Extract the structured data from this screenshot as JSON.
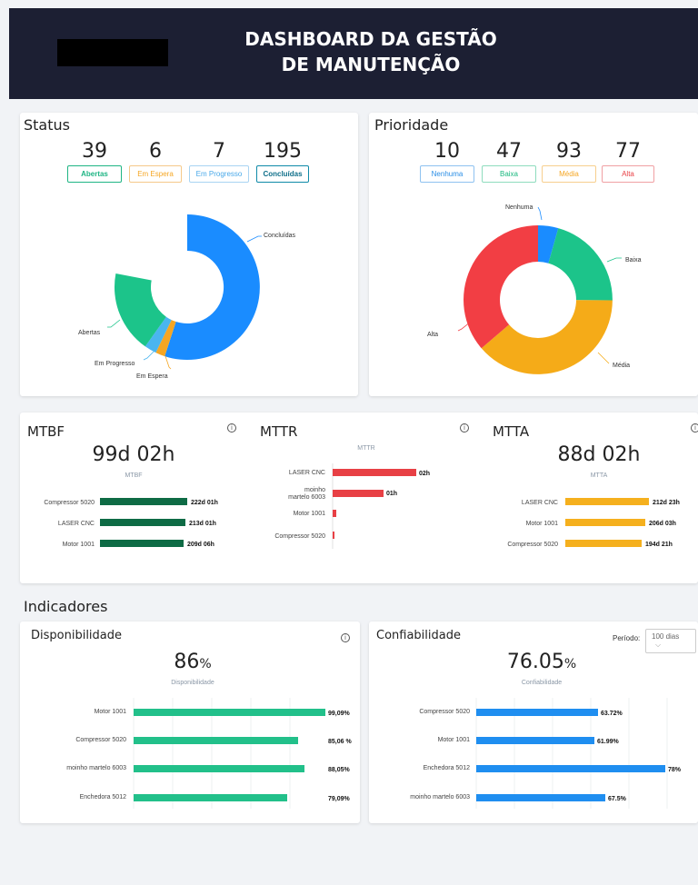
{
  "header": {
    "title_line1": "DASHBOARD DA GESTÃO",
    "title_line2": "DE MANUTENÇÃO"
  },
  "status": {
    "title": "Status",
    "counters": [
      {
        "value": "39",
        "label": "Abertas",
        "color": "#1fb584"
      },
      {
        "value": "6",
        "label": "Em Espera",
        "color": "#f5a623"
      },
      {
        "value": "7",
        "label": "Em Progresso",
        "color": "#4aa9e9"
      },
      {
        "value": "195",
        "label": "Concluídas",
        "color": "#0f8aa8"
      }
    ],
    "chart_labels": {
      "concluidas": "Concluídas",
      "abertas": "Abertas",
      "em_progresso": "Em Progresso",
      "em_espera": "Em Espera"
    }
  },
  "prioridade": {
    "title": "Prioridade",
    "counters": [
      {
        "value": "10",
        "label": "Nenhuma",
        "color": "#2a8ee6"
      },
      {
        "value": "47",
        "label": "Baixa",
        "color": "#19b87e"
      },
      {
        "value": "93",
        "label": "Média",
        "color": "#f5a623"
      },
      {
        "value": "77",
        "label": "Alta",
        "color": "#e84045"
      }
    ],
    "chart_labels": {
      "nenhuma": "Nenhuma",
      "baixa": "Baixa",
      "media": "Média",
      "alta": "Alta"
    }
  },
  "mtbf": {
    "title": "MTBF",
    "value": "99d 02h",
    "sub_label": "MTBF",
    "color": "#0e6b45",
    "bars": [
      {
        "label": "Compressor 5020",
        "value": "222d 01h"
      },
      {
        "label": "LASER CNC",
        "value": "213d 01h"
      },
      {
        "label": "Motor 1001",
        "value": "209d 06h"
      }
    ]
  },
  "mttr": {
    "title": "MTTR",
    "sub_label": "MTTR",
    "color": "#e84045",
    "bars": [
      {
        "label": "LASER CNC",
        "value": "02h"
      },
      {
        "label_line1": "moinho",
        "label_line2": "martelo 6003",
        "value": "01h"
      },
      {
        "label": "Motor 1001",
        "value": ""
      },
      {
        "label": "Compressor 5020",
        "value": ""
      }
    ]
  },
  "mtta": {
    "title": "MTTA",
    "value": "88d 02h",
    "sub_label": "MTTA",
    "color": "#f5b01e",
    "bars": [
      {
        "label": "LASER CNC",
        "value": "212d 23h"
      },
      {
        "label": "Motor 1001",
        "value": "206d 03h"
      },
      {
        "label": "Compressor 5020",
        "value": "194d 21h"
      }
    ]
  },
  "indicadores": {
    "title": "Indicadores",
    "disponibilidade": {
      "title": "Disponibilidade",
      "value": "86",
      "unit": "%",
      "sub_label": "Disponibilidade",
      "color": "#22c08a",
      "bars": [
        {
          "label": "Motor 1001",
          "value": "99,09%",
          "pct": 99.09
        },
        {
          "label": "Compressor 5020",
          "value": "85,06 %",
          "pct": 85.06
        },
        {
          "label": "moinho martelo 6003",
          "value": "88,05%",
          "pct": 88.05
        },
        {
          "label": "Enchedora 5012",
          "value": "79,09%",
          "pct": 79.09
        }
      ]
    },
    "confiabilidade": {
      "title": "Confiabilidade",
      "value": "76.05",
      "unit": "%",
      "sub_label": "Confiabilidade",
      "color": "#1f8ef0",
      "period_label": "Período:",
      "period_value": "100 dias",
      "bars": [
        {
          "label": "Compressor 5020",
          "value": "63.72%",
          "pct": 63.72
        },
        {
          "label": "Motor 1001",
          "value": "61.99%",
          "pct": 61.99
        },
        {
          "label": "Enchedora 5012",
          "value": "78%",
          "pct": 78
        },
        {
          "label": "moinho martelo 6003",
          "value": "67.5%",
          "pct": 67.5
        }
      ]
    }
  }
}
